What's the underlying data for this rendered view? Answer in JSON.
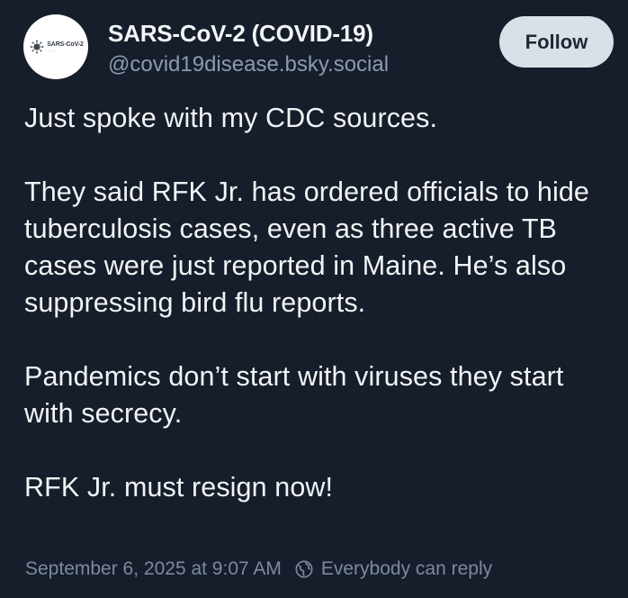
{
  "author": {
    "display_name": "SARS-CoV-2 (COVID-19)",
    "handle": "@covid19disease.bsky.social",
    "avatar_brand": "SARS-CoV-2",
    "avatar_icon": "virus-logo-icon"
  },
  "actions": {
    "follow_label": "Follow"
  },
  "post": {
    "paragraphs": [
      "Just spoke with my CDC sources.",
      "They said RFK Jr. has ordered officials to hide tuberculosis cases, even as three active TB cases were just reported in Maine. He’s also suppressing bird flu reports.",
      "Pandemics don’t start with viruses they start with secrecy.",
      "RFK Jr. must resign now!"
    ]
  },
  "meta": {
    "timestamp": "September 6, 2025 at 9:07 AM",
    "reply_setting_icon": "globe-icon",
    "reply_setting": "Everybody can reply"
  },
  "colors": {
    "background": "#161e2b",
    "text": "#f1f3f5",
    "muted": "#7d8a9b",
    "handle": "#8c9aab",
    "button_bg": "#d9e0e8"
  }
}
